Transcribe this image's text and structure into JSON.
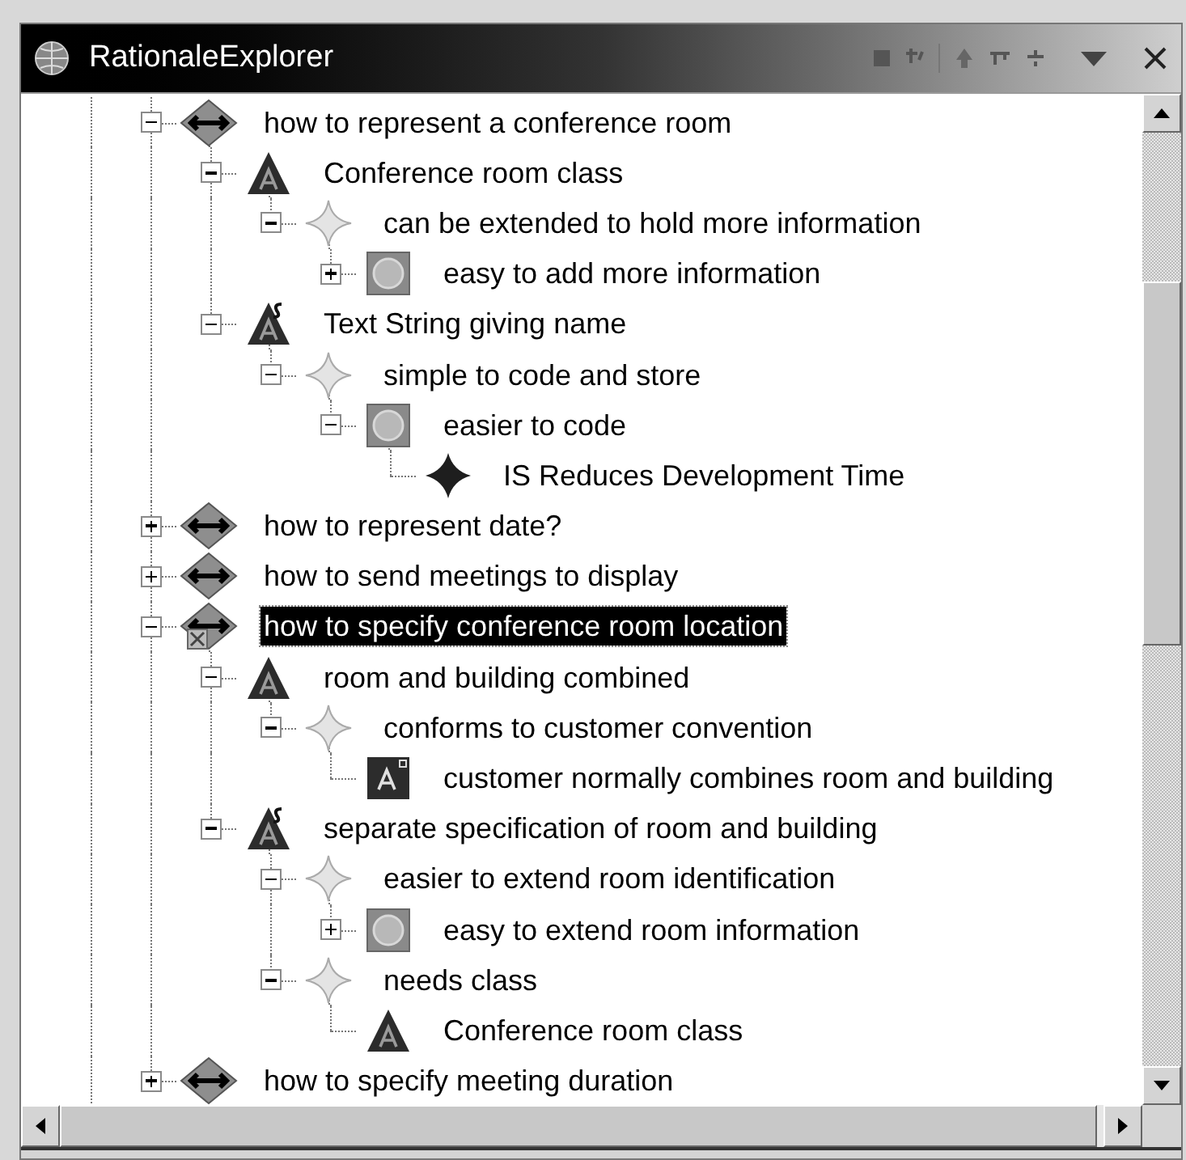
{
  "window": {
    "title": "RationaleExplorer"
  },
  "tree": [
    {
      "kind": "question",
      "text": "how to represent a conference room",
      "expanded": true,
      "selected": false,
      "flagged": false,
      "children": [
        {
          "kind": "alternative",
          "text": "Conference room class",
          "expanded": true,
          "selected": false,
          "chosen": false,
          "children": [
            {
              "kind": "argument",
              "text": "can be extended to hold more information",
              "expanded": true,
              "selected": false,
              "children": [
                {
                  "kind": "claim",
                  "text": "easy to add more information",
                  "expanded": false,
                  "selected": false
                }
              ]
            }
          ]
        },
        {
          "kind": "alternative",
          "text": "Text String giving name",
          "expanded": true,
          "selected": false,
          "chosen": true,
          "children": [
            {
              "kind": "argument",
              "text": "simple to code and store",
              "expanded": true,
              "selected": false,
              "children": [
                {
                  "kind": "claim",
                  "text": "easier to code",
                  "expanded": true,
                  "selected": false,
                  "children": [
                    {
                      "kind": "requirement",
                      "text": "IS Reduces Development Time",
                      "selected": false
                    }
                  ]
                }
              ]
            }
          ]
        }
      ]
    },
    {
      "kind": "question",
      "text": "how to represent date?",
      "expanded": false,
      "selected": false,
      "flagged": false
    },
    {
      "kind": "question",
      "text": "how to send meetings to display",
      "expanded": false,
      "selected": false,
      "flagged": false
    },
    {
      "kind": "question",
      "text": "how to specify conference room location",
      "expanded": true,
      "selected": true,
      "flagged": true,
      "children": [
        {
          "kind": "alternative",
          "text": "room and building combined",
          "expanded": true,
          "selected": false,
          "chosen": false,
          "children": [
            {
              "kind": "argument",
              "text": "conforms to customer convention",
              "expanded": true,
              "selected": false,
              "children": [
                {
                  "kind": "assumption",
                  "text": "customer normally combines room and building",
                  "selected": false
                }
              ]
            }
          ]
        },
        {
          "kind": "alternative",
          "text": "separate specification of room and building",
          "expanded": true,
          "selected": false,
          "chosen": true,
          "children": [
            {
              "kind": "argument",
              "text": "easier to extend room identification",
              "expanded": true,
              "selected": false,
              "children": [
                {
                  "kind": "claim",
                  "text": "easy to extend room information",
                  "expanded": false,
                  "selected": false
                }
              ]
            },
            {
              "kind": "argument",
              "text": "needs class",
              "expanded": true,
              "selected": false,
              "children": [
                {
                  "kind": "alternative",
                  "text": "Conference room class",
                  "selected": false,
                  "chosen": false
                }
              ]
            }
          ]
        }
      ]
    },
    {
      "kind": "question",
      "text": "how to specify meeting duration",
      "expanded": false,
      "selected": false,
      "flagged": false
    }
  ]
}
